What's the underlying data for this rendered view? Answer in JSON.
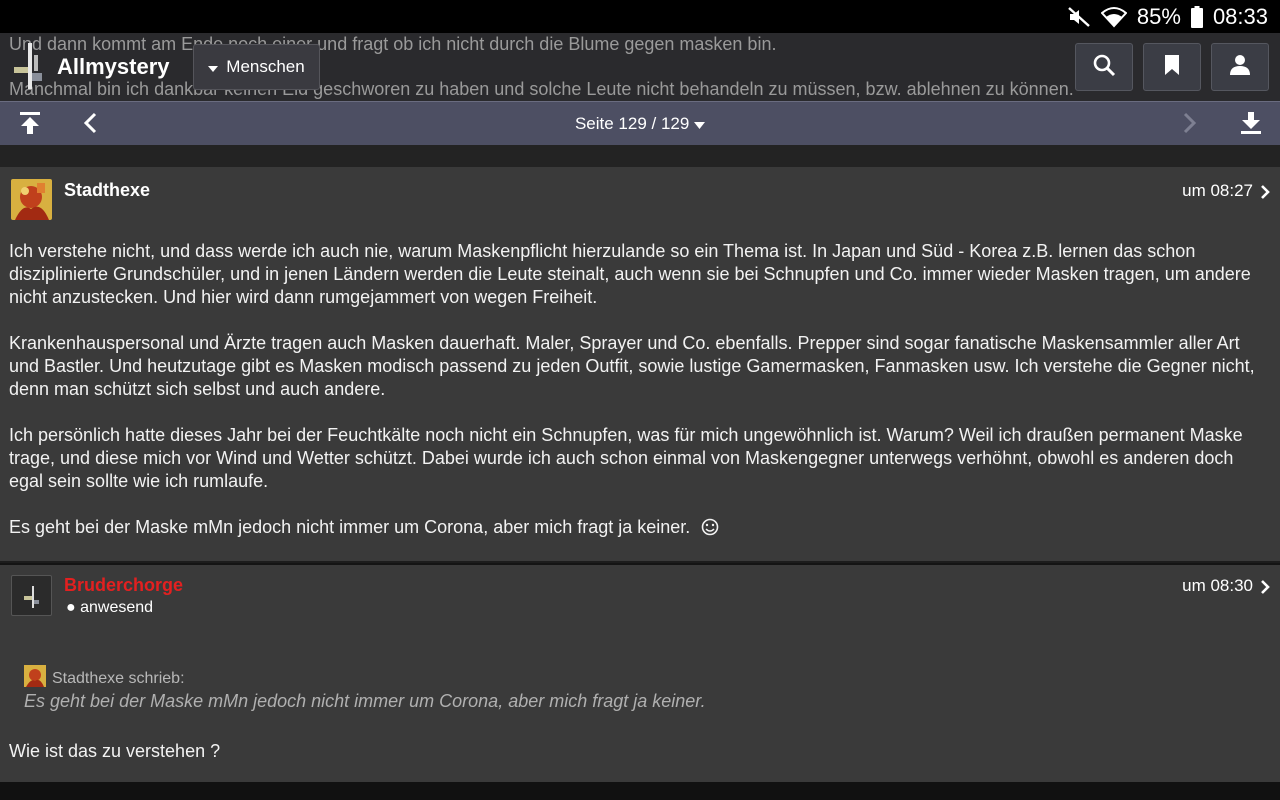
{
  "status_bar": {
    "battery": "85%",
    "time": "08:33"
  },
  "header": {
    "background_lines": [
      "Und dann kommt am Ende noch einer und fragt ob ich nicht durch die Blume gegen masken bin.",
      "Manchmal bin ich dankbar keinen Eid geschworen zu haben und solche Leute nicht behandeln zu müssen, bzw. ablehnen zu können."
    ],
    "site_name": "Allmystery",
    "menu_label": "Menschen"
  },
  "pagination": {
    "label": "Seite 129 / 129"
  },
  "posts": [
    {
      "author": "Stadthexe",
      "time": "um 08:27",
      "paragraphs": [
        "Ich verstehe nicht, und dass werde ich auch nie, warum Maskenpflicht hierzulande so ein Thema ist. In Japan und Süd - Korea z.B. lernen das schon disziplinierte Grundschüler, und in jenen Ländern werden die Leute steinalt, auch wenn sie bei Schnupfen und Co. immer wieder Masken tragen, um andere nicht anzustecken. Und hier wird dann rumgejammert von wegen Freiheit.",
        "Krankenhauspersonal und Ärzte tragen auch Masken dauerhaft. Maler, Sprayer und Co. ebenfalls. Prepper sind sogar fanatische Maskensammler aller Art und Bastler. Und heutzutage gibt es Masken modisch passend zu jeden Outfit, sowie lustige Gamermasken, Fanmasken usw. Ich verstehe die Gegner nicht, denn man schützt sich selbst und auch andere.",
        "Ich persönlich hatte dieses Jahr bei der Feuchtkälte noch nicht ein Schnupfen, was für mich ungewöhnlich ist. Warum? Weil ich draußen permanent Maske trage, und diese mich vor Wind und Wetter schützt. Dabei wurde ich auch schon einmal von Maskengegner unterwegs verhöhnt, obwohl es anderen doch egal sein sollte wie ich rumlaufe.",
        "Es geht bei der Maske mMn jedoch nicht immer um Corona, aber mich fragt ja keiner."
      ]
    },
    {
      "author": "Bruderchorge",
      "author_color": "#e32020",
      "status": "anwesend",
      "time": "um 08:30",
      "quote_author": "Stadthexe schrieb:",
      "quote_text": "Es geht bei der Maske mMn jedoch nicht immer um Corona, aber mich fragt ja keiner.",
      "reply": "Wie ist das zu verstehen ?"
    }
  ]
}
